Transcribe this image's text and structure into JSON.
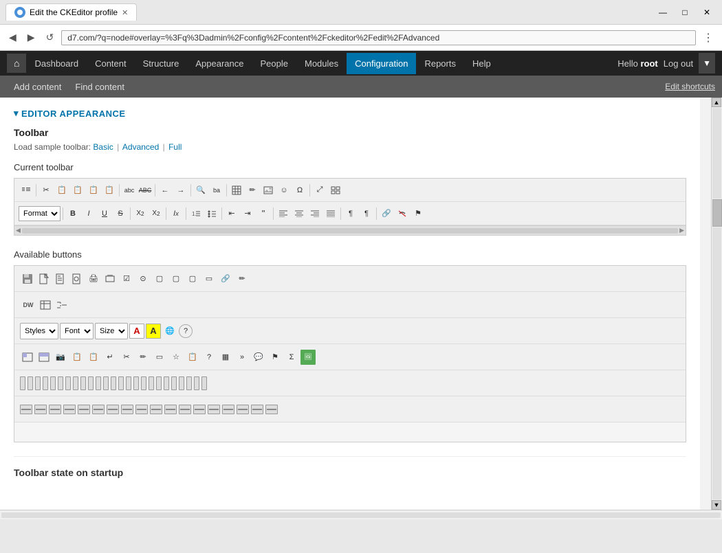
{
  "browser": {
    "tab_title": "Edit the CKEditor profile",
    "url": "d7.com/?q=node#overlay=%3Fq%3Dadmin%2Fconfig%2Fcontent%2Fckeditor%2Fedit%2FAdvanced",
    "nav_back": "◀",
    "nav_forward": "▶",
    "nav_refresh": "↺",
    "win_minimize": "—",
    "win_maximize": "□",
    "win_close": "✕"
  },
  "drupal_nav": {
    "home_icon": "⌂",
    "items": [
      "Dashboard",
      "Content",
      "Structure",
      "Appearance",
      "People",
      "Modules",
      "Configuration",
      "Reports",
      "Help"
    ],
    "active_item": "Configuration",
    "user_text": "Hello",
    "user_name": "root",
    "logout_label": "Log out"
  },
  "secondary_nav": {
    "items": [
      "Add content",
      "Find content"
    ],
    "edit_shortcuts": "Edit shortcuts"
  },
  "editor_appearance": {
    "section_title": "EDITOR APPEARANCE",
    "toolbar_label": "Toolbar",
    "sample_toolbar_text": "Load sample toolbar:",
    "sample_options": [
      "Basic",
      "Advanced",
      "Full"
    ],
    "current_toolbar_label": "Current toolbar",
    "available_buttons_label": "Available buttons"
  },
  "toolbar_state": {
    "label": "Toolbar state on startup"
  },
  "toolbar_row1_icons": [
    "📄",
    "✂",
    "📋",
    "📋",
    "📋",
    "📋",
    "—",
    "abc",
    "ABC",
    "←",
    "→",
    "🔍",
    "ba",
    "—",
    "⊞",
    "✏",
    "⊟",
    "✎",
    "⊞",
    "☺",
    "Ω",
    "—",
    "⤢",
    "▦"
  ],
  "toolbar_row2_icons": [
    "B",
    "I",
    "U",
    "S",
    "—",
    "X₂",
    "X²",
    "—",
    "Iₓ",
    "—",
    "≡",
    "≡",
    "—",
    "⇤",
    "⇥",
    "❝",
    "—",
    "≡",
    "≡",
    "≡",
    "≡",
    "—",
    "¶",
    "¶",
    "—",
    "🔗",
    "🔗",
    "⚑"
  ],
  "avail_row1_icons": [
    "💾",
    "📄",
    "📄",
    "📄",
    "🖨",
    "🖨",
    "☑",
    "⊙",
    "▢",
    "▢",
    "▢",
    "▭",
    "🔗",
    "✏"
  ],
  "avail_row2_icons": [
    "DW",
    "⊞",
    "≡"
  ],
  "avail_row3_selects": [
    "Styles",
    "Font",
    "Size"
  ],
  "avail_row3_icons": [
    "A",
    "A",
    "🌐",
    "?"
  ],
  "avail_row4_icons": [
    "⊟",
    "☰",
    "📷",
    "📋",
    "📋",
    "↵",
    "✂",
    "✎",
    "▭",
    "☆",
    "📋",
    "?",
    "▦",
    "»",
    "💬",
    "⚑",
    "Σ",
    "🖼"
  ],
  "colors": {
    "accent": "#0073aa",
    "section_title": "#0073aa",
    "nav_bg": "#222222",
    "active_nav": "#0073aa"
  }
}
